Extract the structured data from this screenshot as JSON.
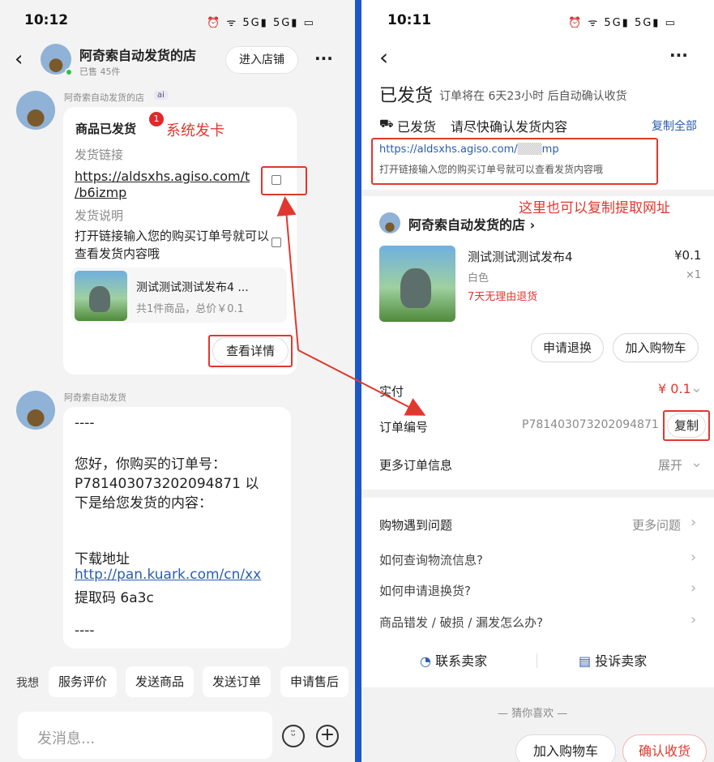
{
  "left": {
    "status_time": "10:12",
    "status_icons": "⏰ ᯤ 5G▮ 5G▮ ▭",
    "header": {
      "shop_name": "阿奇索自动发货的店",
      "sold": "已售 45件",
      "enter_shop": "进入店铺",
      "more": "···"
    },
    "msg1": {
      "sender": "阿奇索自动发货的店",
      "ai_tag": "ai",
      "badge": "1",
      "title": "商品已发货",
      "annotation": "系统发卡",
      "link_label": "发货链接",
      "link_line1": "https://aldsxhs.agiso.com/t",
      "link_line2": "/b6izmp",
      "desc_label": "发货说明",
      "desc_text": "打开链接输入您的购买订单号就可以查看发货内容哦",
      "product_name": "测试测试测试发布4 ...",
      "product_info": "共1件商品，总价￥0.1",
      "detail_button": "查看详情"
    },
    "msg2": {
      "sender": "阿奇索自动发货",
      "dashes_top": "----",
      "line1": "您好，你购买的订单号：",
      "line2": "P781403073202094871 以",
      "line3": "下是给您发货的内容：",
      "download_label": "下载地址",
      "download_url": "http://pan.kuark.com/cn/xx",
      "code": "提取码 6a3c",
      "dashes_bottom": "----"
    },
    "quick": {
      "label": "我想",
      "items": [
        "服务评价",
        "发送商品",
        "发送订单",
        "申请售后"
      ]
    },
    "input": {
      "placeholder": "发消息..."
    }
  },
  "right": {
    "status_time": "10:11",
    "status_icons": "⏰ ᯤ 5G▮ 5G▮ ▭",
    "more": "···",
    "title": "已发货",
    "subtitle": "订单将在 6天23小时 后自动确认收货",
    "shipped_label": "已发货",
    "shipped_hint": "请尽快确认发货内容",
    "copy_all": "复制全部",
    "delivery_url": "https://aldsxhs.agiso.com/",
    "delivery_url_tail": "mp",
    "delivery_desc": "打开链接输入您的购买订单号就可以查看发货内容哦",
    "annotation": "这里也可以复制提取网址",
    "shop_name": "阿奇索自动发货的店",
    "product": {
      "name": "测试测试测试发布4",
      "price": "¥0.1",
      "variant": "白色",
      "qty": "×1",
      "return_policy": "7天无理由退货"
    },
    "buttons": {
      "refund": "申请退换",
      "add_cart": "加入购物车"
    },
    "paid_label": "实付",
    "paid_value": "¥ 0.1",
    "order_no_label": "订单编号",
    "order_no_value": "P7814030732020948​71",
    "copy": "复制",
    "more_info_label": "更多订单信息",
    "expand": "展开",
    "faq": {
      "title": "购物遇到问题",
      "more": "更多问题",
      "items": [
        "如何查询物流信息?",
        "如何申请退换货?",
        "商品错发 / 破损 / 漏发怎么办?"
      ]
    },
    "contact_seller": "联系卖家",
    "complain_seller": "投诉卖家",
    "guess": "— 猜你喜欢 —",
    "bottom": {
      "add_cart": "加入购物车",
      "confirm": "确认收货"
    }
  },
  "colors": {
    "accent_red": "#e0382e",
    "divider_blue": "#1d56c6",
    "link_blue": "#2a5db0"
  }
}
